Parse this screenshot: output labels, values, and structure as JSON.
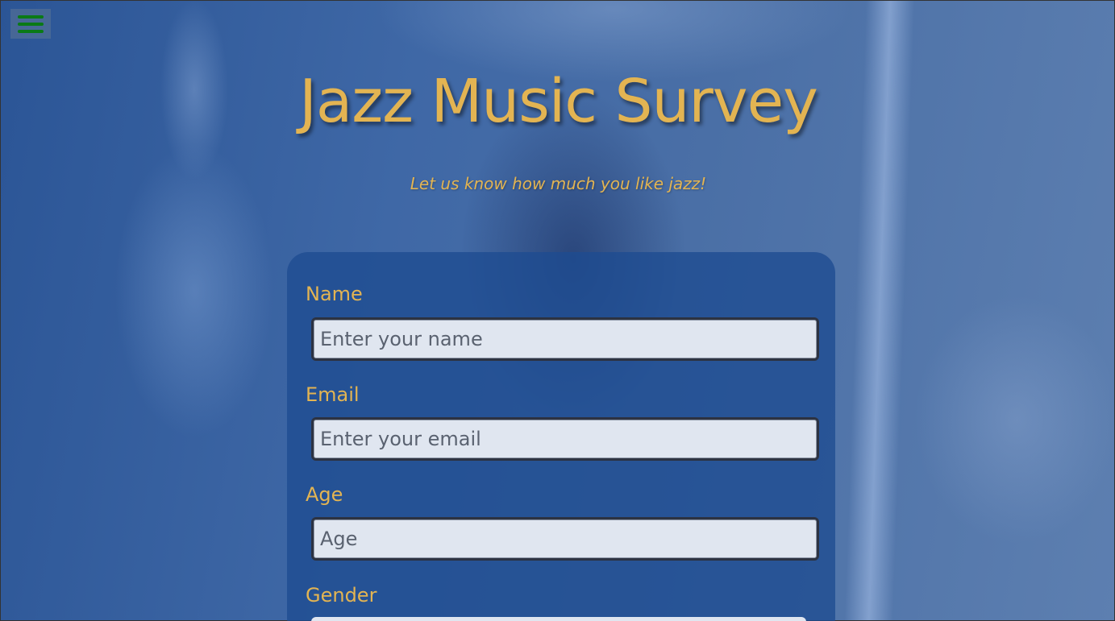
{
  "header": {
    "title": "Jazz Music Survey",
    "subtitle": "Let us know how much you like jazz!"
  },
  "menu": {
    "icon": "hamburger-menu-icon"
  },
  "form": {
    "name": {
      "label": "Name",
      "placeholder": "Enter your name"
    },
    "email": {
      "label": "Email",
      "placeholder": "Enter your email"
    },
    "age": {
      "label": "Age",
      "placeholder": "Age"
    },
    "gender": {
      "label": "Gender"
    }
  },
  "colors": {
    "accent": "#e3b452",
    "menu_icon": "#0a7a16",
    "card": "#1e4b91",
    "input_bg": "#e0e6f0"
  }
}
